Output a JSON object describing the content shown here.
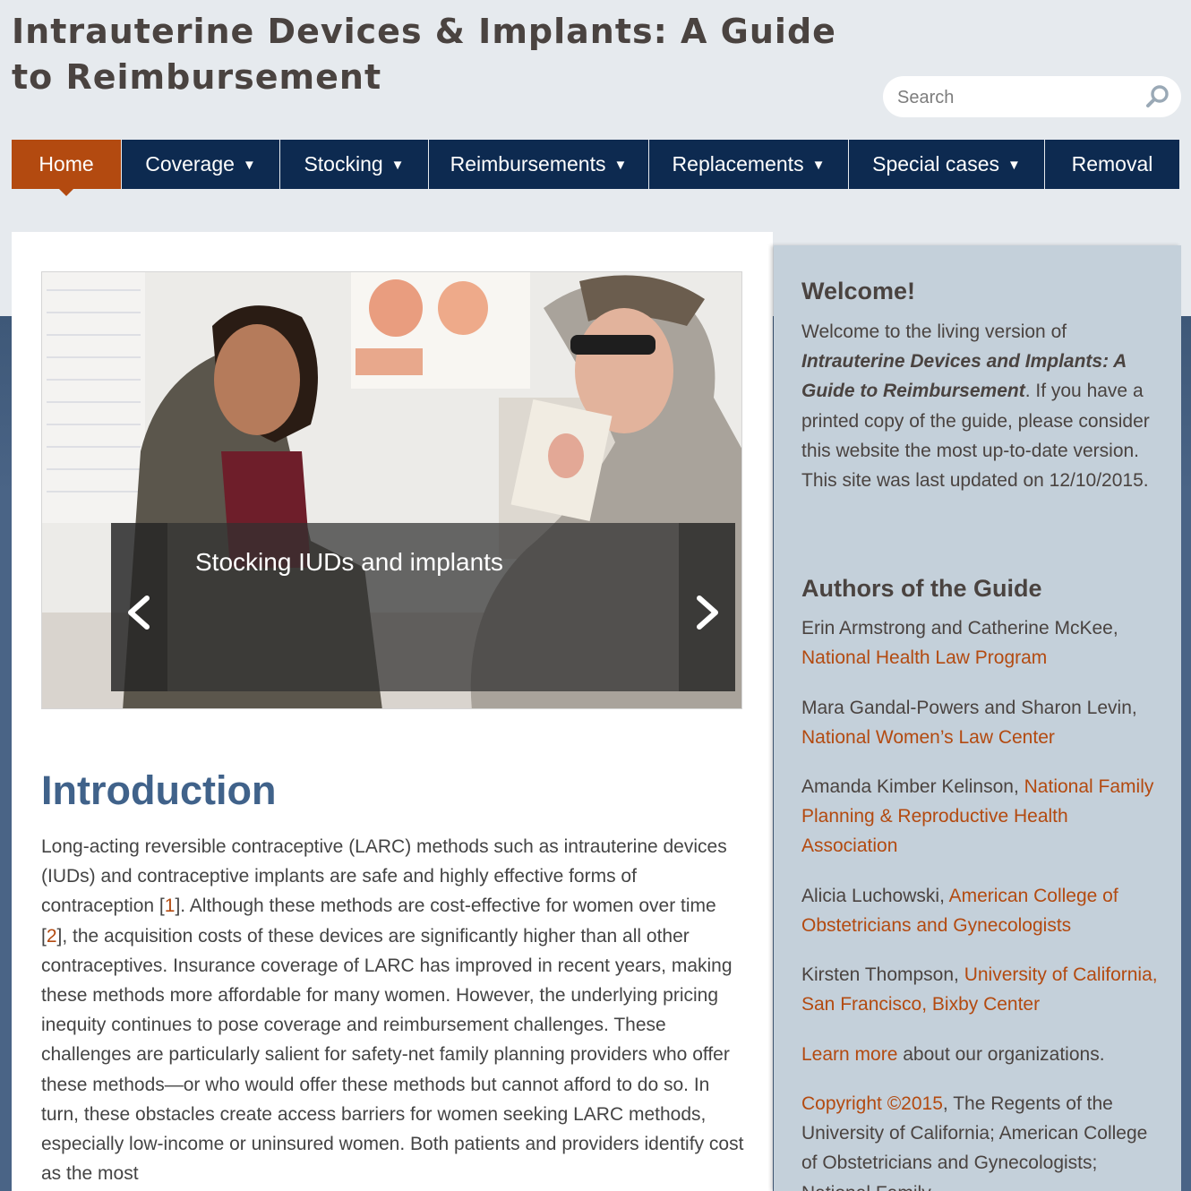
{
  "site": {
    "title": "Intrauterine Devices & Implants: A Guide to Reimbursement"
  },
  "search": {
    "placeholder": "Search"
  },
  "nav": {
    "items": [
      {
        "label": "Home"
      },
      {
        "label": "Coverage"
      },
      {
        "label": "Stocking"
      },
      {
        "label": "Reimbursements"
      },
      {
        "label": "Replacements"
      },
      {
        "label": "Special cases"
      },
      {
        "label": "Removal"
      }
    ],
    "caret": "▼"
  },
  "slider": {
    "caption": "Stocking IUDs and implants"
  },
  "intro": {
    "heading": "Introduction",
    "p1": "Long-acting reversible contraceptive (LARC) methods such as intrauterine devices (IUDs) and contraceptive implants are safe and highly effective forms of contraception [",
    "ref1": "1",
    "p2": "]. Although these methods are cost-effective for women over time [",
    "ref2": "2",
    "p3": "], the acquisition costs of these devices are significantly higher than all other contraceptives. Insurance coverage of LARC has improved in recent years, making these methods more affordable for many women. However, the underlying pricing inequity continues to pose coverage and reimbursement challenges. These challenges are particularly salient for safety-net family planning providers who offer these methods—or who would offer these methods but cannot afford to do so. In turn, these obstacles create access barriers for women seeking LARC methods, especially low-income or uninsured women. Both patients and providers identify cost as the most"
  },
  "sidebar": {
    "welcome_heading": "Welcome!",
    "welcome_pre": "Welcome to the living version of ",
    "welcome_title": "Intrauterine Devices and Implants: A Guide to Reimbursement",
    "welcome_post": ". If you have a printed copy of the guide, please consider this website the most up-to-date version. This site was last updated on 12/10/2015.",
    "authors_heading": "Authors of the Guide",
    "authors": [
      {
        "names": "Erin Armstrong and Catherine McKee, ",
        "org": "National Health Law Program"
      },
      {
        "names": "Mara Gandal-Powers and Sharon Levin, ",
        "org": "National Women’s Law Center"
      },
      {
        "names": "Amanda Kimber Kelinson, ",
        "org": "National Family Planning & Reproductive Health Association"
      },
      {
        "names": "Alicia Luchowski, ",
        "org": "American College of Obstetricians and Gynecologists"
      },
      {
        "names": "Kirsten Thompson, ",
        "org": "University of California, San Francisco, Bixby Center"
      }
    ],
    "learn_more_link": "Learn more",
    "learn_more_rest": " about our organizations.",
    "copyright_link": "Copyright ©2015",
    "copyright_rest": ", The Regents of the University of California; American College of Obstetricians and Gynecologists; National Family"
  },
  "colors": {
    "nav_bg": "#0d2a50",
    "nav_active": "#b34a10",
    "link": "#b34a10",
    "heading_blue": "#40628a",
    "sidebar_bg": "#c4d0da"
  }
}
